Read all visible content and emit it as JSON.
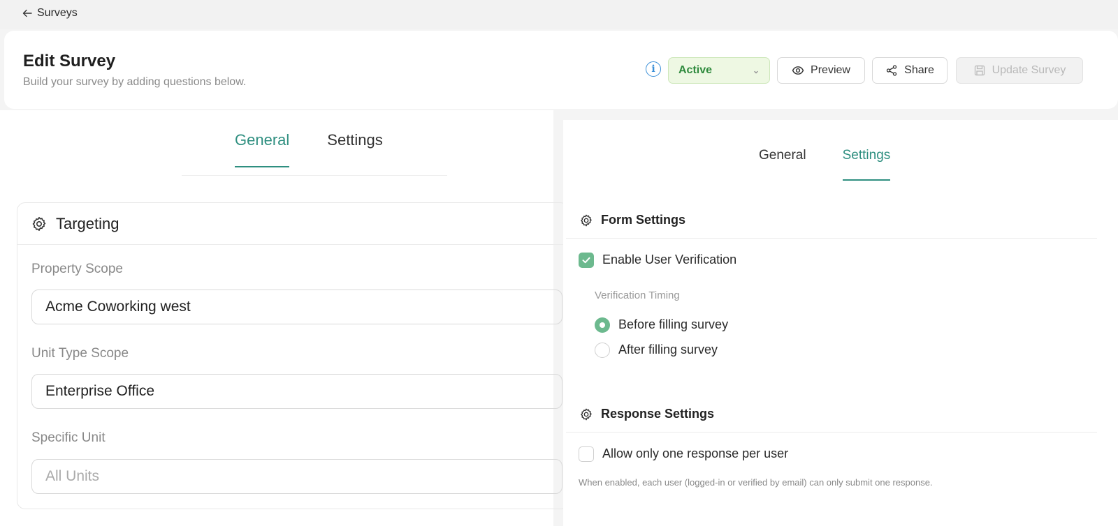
{
  "nav": {
    "back_label": "Surveys"
  },
  "header": {
    "title": "Edit Survey",
    "subtitle": "Build your survey by adding questions below.",
    "status": "Active",
    "preview_label": "Preview",
    "share_label": "Share",
    "update_label": "Update Survey"
  },
  "left": {
    "tabs": [
      {
        "label": "General"
      },
      {
        "label": "Settings"
      }
    ],
    "targeting": {
      "title": "Targeting",
      "property_scope_label": "Property Scope",
      "property_scope_value": "Acme Coworking west",
      "unit_type_label": "Unit Type Scope",
      "unit_type_value": "Enterprise Office",
      "specific_unit_label": "Specific Unit",
      "specific_unit_placeholder": "All Units"
    }
  },
  "right": {
    "tabs": [
      {
        "label": "General"
      },
      {
        "label": "Settings"
      }
    ],
    "form_settings": {
      "title": "Form Settings",
      "enable_verification_label": "Enable User Verification",
      "enable_verification_checked": true,
      "timing_label": "Verification Timing",
      "options": [
        {
          "label": "Before filling survey",
          "selected": true
        },
        {
          "label": "After filling survey",
          "selected": false
        }
      ]
    },
    "response_settings": {
      "title": "Response Settings",
      "one_response_label": "Allow only one response per user",
      "one_response_checked": false,
      "note": "When enabled, each user (logged-in or verified by email) can only submit one response."
    }
  },
  "colors": {
    "accent": "#2f8f80",
    "check": "#6cb98e",
    "status_text": "#2f8a3d",
    "info": "#3a8fd8"
  }
}
